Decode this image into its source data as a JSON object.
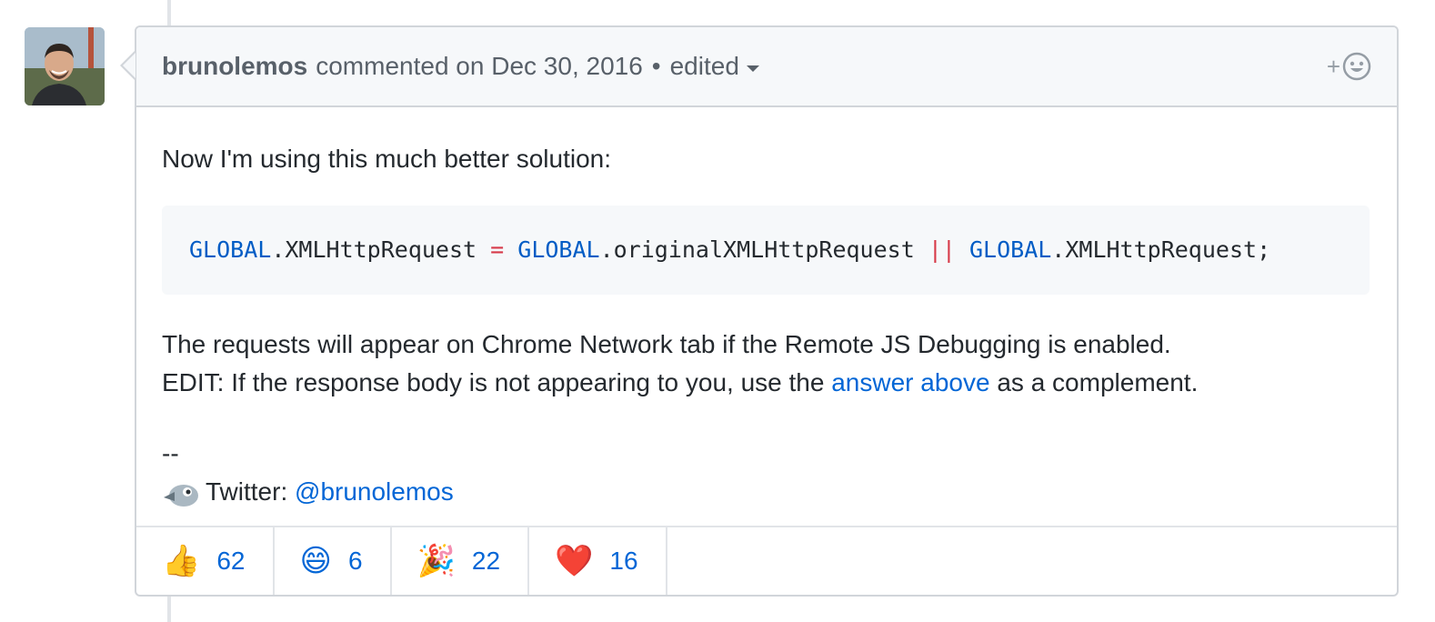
{
  "comment": {
    "author": "brunolemos",
    "action": "commented on Dec 30, 2016",
    "bullet": "•",
    "edited_label": "edited",
    "add_reaction_symbol": "+",
    "body": {
      "intro": "Now I'm using this much better solution:",
      "code": {
        "g1": "GLOBAL",
        "t1": ".XMLHttpRequest ",
        "op1": "=",
        "sp1": " ",
        "g2": "GLOBAL",
        "t2": ".originalXMLHttpRequest ",
        "op2": "||",
        "sp2": " ",
        "g3": "GLOBAL",
        "t3": ".XMLHttpRequest;"
      },
      "line1": "The requests will appear on Chrome Network tab if the Remote JS Debugging is enabled.",
      "line2_prefix": "EDIT: If the response body is not appearing to you, use the ",
      "line2_link": "answer above",
      "line2_suffix": " as a complement.",
      "sig_dashes": "--",
      "twitter_label": "Twitter: ",
      "twitter_handle": "@brunolemos"
    },
    "reactions": [
      {
        "emoji": "👍",
        "icon": "thumbs-up-icon",
        "count": "62"
      },
      {
        "emoji": "😄",
        "icon": "smile-icon",
        "count": "6"
      },
      {
        "emoji": "🎉",
        "icon": "tada-icon",
        "count": "22"
      },
      {
        "emoji": "❤️",
        "icon": "heart-icon",
        "count": "16"
      }
    ]
  },
  "colors": {
    "link": "#0366d6",
    "code_constant": "#005cc5",
    "code_operator": "#d73a49",
    "header_bg": "#f6f8fa",
    "border": "#d1d5da"
  }
}
